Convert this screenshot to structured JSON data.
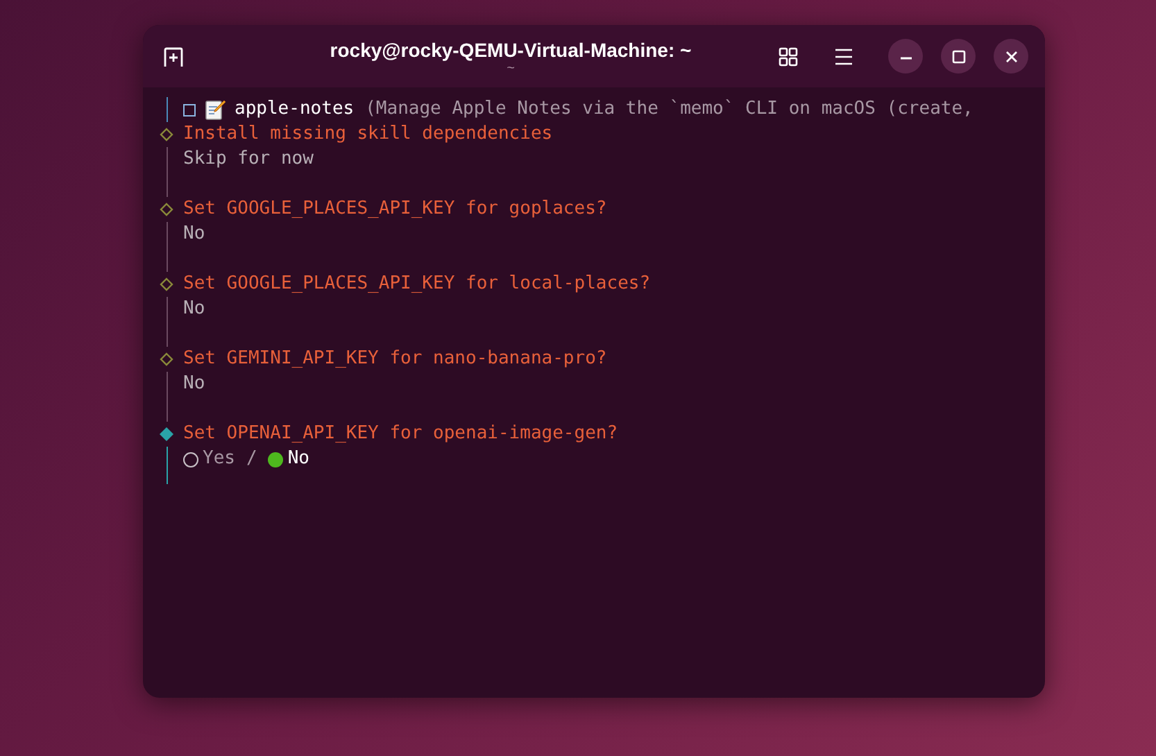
{
  "window": {
    "title": "rocky@rocky-QEMU-Virtual-Machine: ~",
    "subtitle": "~"
  },
  "header": {
    "checked": false,
    "name": "apple-notes",
    "description": "(Manage Apple Notes via the `memo` CLI on macOS (create,"
  },
  "steps": [
    {
      "prompt": "Install missing skill dependencies",
      "answer": "Skip for now",
      "active": false
    },
    {
      "prompt": "Set GOOGLE_PLACES_API_KEY for goplaces?",
      "answer": "No",
      "active": false
    },
    {
      "prompt": "Set GOOGLE_PLACES_API_KEY for local-places?",
      "answer": "No",
      "active": false
    },
    {
      "prompt": "Set GEMINI_API_KEY for nano-banana-pro?",
      "answer": "No",
      "active": false
    },
    {
      "prompt": "Set OPENAI_API_KEY for openai-image-gen?",
      "active": true,
      "separator": "/",
      "options": [
        {
          "label": "Yes",
          "selected": false
        },
        {
          "label": "No",
          "selected": true
        }
      ]
    }
  ]
}
